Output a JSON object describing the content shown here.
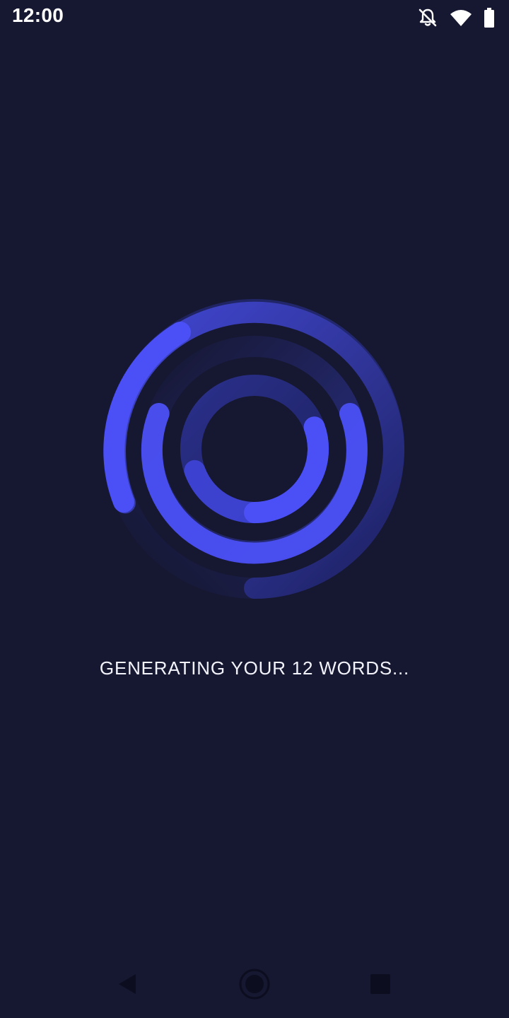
{
  "status_bar": {
    "time": "12:00",
    "icons": [
      "bell-off-icon",
      "wifi-icon",
      "battery-icon"
    ]
  },
  "loader": {
    "type": "concentric-ring-spinner",
    "colors": {
      "accent": "#4B50F6",
      "track_outer": "#2A2F8A",
      "track_mid": "#22286E",
      "background": "#161731"
    }
  },
  "main": {
    "loading_text": "GENERATING YOUR 12 WORDS..."
  },
  "nav_bar": {
    "icons": [
      "back-icon",
      "home-icon",
      "recents-icon"
    ]
  }
}
